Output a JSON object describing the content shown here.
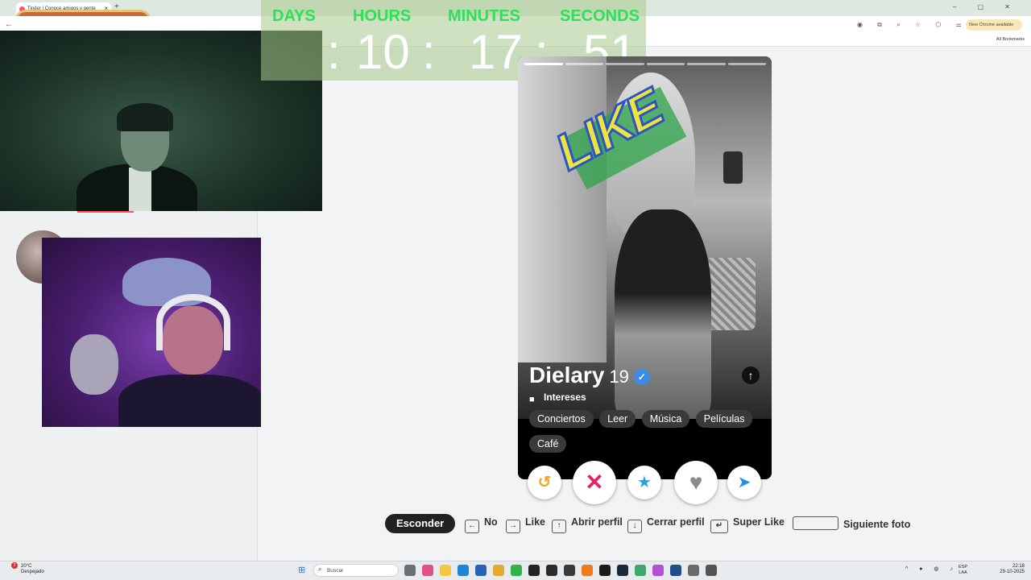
{
  "browser": {
    "tab_title": "Tinder | Conoce amigos y gente",
    "tab_close": "×",
    "new_tab": "+",
    "window_controls": "–  ▢  ✕",
    "back": "←",
    "update_label": "New Chrome available",
    "all_bookmarks": "All Bookmarks"
  },
  "timer": {
    "labels": {
      "days": "DAYS",
      "hours": "HOURS",
      "minutes": "MINUTES",
      "seconds": "SECONDS"
    },
    "sep1": ":",
    "hours": "10",
    "sep2": ":",
    "minutes": "17",
    "sep3": ":",
    "seconds": "51",
    "label_color": "#2ee05a"
  },
  "profile": {
    "name": "Dielary",
    "age": "19",
    "verified_icon": "✓",
    "info_icon": "↑",
    "interests_label": "Intereses",
    "interests_icon": "■",
    "interests": [
      "Conciertos",
      "Leer",
      "Música",
      "Películas",
      "Café"
    ],
    "stamp": "LIKE",
    "photo_count": 6,
    "active_photo": 1
  },
  "actions": {
    "rewind_icon": "↺",
    "nope_icon": "✕",
    "superlike_icon": "★",
    "like_icon": "♥",
    "boost_icon": "➤"
  },
  "shortcuts": {
    "hide": "Esconder",
    "no_key": "←",
    "no": "No",
    "like_key": "→",
    "like": "Like",
    "open_key": "↑",
    "open": "Abrir perfil",
    "close_key": "↓",
    "close": "Cerrar perfil",
    "super_key": "↵",
    "super": "Super Like",
    "next_key": "",
    "next": "Siguiente foto"
  },
  "taskbar": {
    "weather_badge": "2",
    "temp": "20°C",
    "condition": "Despejado",
    "search_placeholder": "Buscar",
    "lang_top": "ESP",
    "lang_bottom": "LAA",
    "time": "22:18",
    "date": "29-10-2025"
  },
  "colors": {
    "brand": "#fd5068",
    "nope": "#ea1f66",
    "superlike": "#2ba0e0",
    "rewind": "#f3a52c"
  }
}
